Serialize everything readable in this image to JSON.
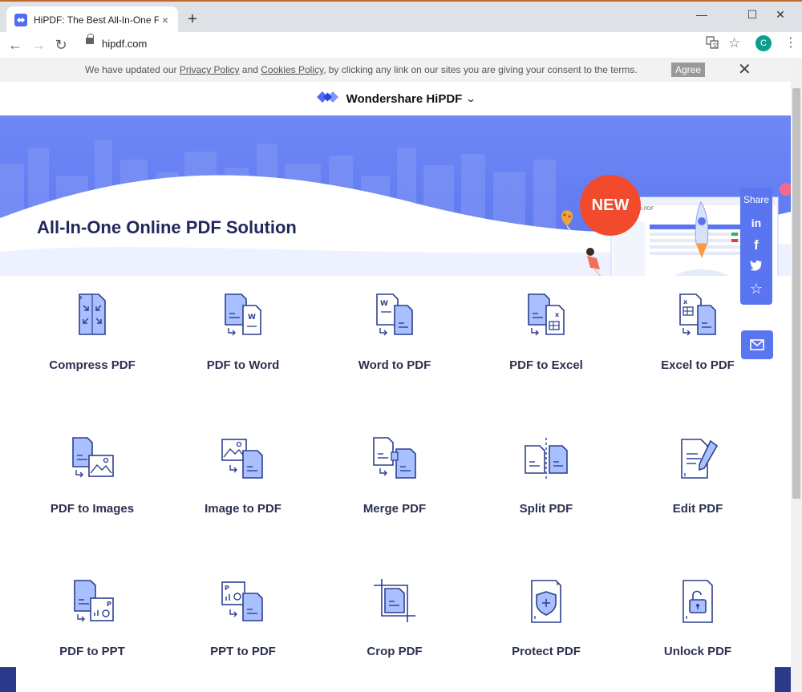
{
  "browser": {
    "tab_title": "HiPDF: The Best All-In-One Free",
    "tab_close": "×",
    "new_tab": "+",
    "minimize": "—",
    "maximize": "☐",
    "close": "✕",
    "back": "←",
    "forward": "→",
    "reload": "↻",
    "url": "hipdf.com",
    "avatar_letter": "C"
  },
  "cookie": {
    "text_before": "We have updated our ",
    "privacy_link": "Privacy Policy",
    "text_and": " and ",
    "cookies_link": "Cookies Policy",
    "text_after": ", by clicking any link on our sites you are giving your consent to the terms.",
    "agree": "Agree",
    "close": "✕"
  },
  "brand": {
    "name": "Wondershare HiPDF",
    "chevron": "⌄"
  },
  "hero": {
    "title": "All-In-One Online PDF Solution",
    "badge": "NEW",
    "mock_title": "File to PDF"
  },
  "tools": [
    {
      "label": "Compress PDF",
      "icon": "compress-icon"
    },
    {
      "label": "PDF to Word",
      "icon": "pdf-to-word-icon"
    },
    {
      "label": "Word to PDF",
      "icon": "word-to-pdf-icon"
    },
    {
      "label": "PDF to Excel",
      "icon": "pdf-to-excel-icon"
    },
    {
      "label": "Excel to PDF",
      "icon": "excel-to-pdf-icon"
    },
    {
      "label": "PDF to Images",
      "icon": "pdf-to-images-icon"
    },
    {
      "label": "Image to PDF",
      "icon": "image-to-pdf-icon"
    },
    {
      "label": "Merge PDF",
      "icon": "merge-icon"
    },
    {
      "label": "Split PDF",
      "icon": "split-icon"
    },
    {
      "label": "Edit PDF",
      "icon": "edit-icon"
    },
    {
      "label": "PDF to PPT",
      "icon": "pdf-to-ppt-icon"
    },
    {
      "label": "PPT to PDF",
      "icon": "ppt-to-pdf-icon"
    },
    {
      "label": "Crop PDF",
      "icon": "crop-icon"
    },
    {
      "label": "Protect PDF",
      "icon": "protect-icon"
    },
    {
      "label": "Unlock PDF",
      "icon": "unlock-icon"
    }
  ],
  "share": {
    "label": "Share",
    "linkedin": "in",
    "facebook": "f",
    "twitter": "🐦",
    "favorite": "☆"
  },
  "colors": {
    "accent": "#5a75f0",
    "title": "#23285c",
    "icon_fill": "#a8c0ff",
    "icon_stroke": "#2f3f8f"
  }
}
